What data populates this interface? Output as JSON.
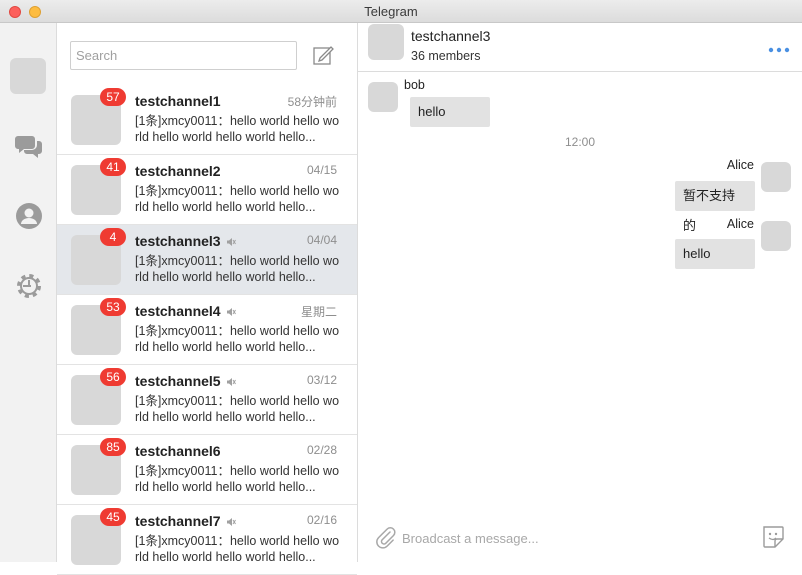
{
  "window": {
    "title": "Telegram"
  },
  "colors": {
    "badge": "#ef3b32",
    "active_row": "#e4e7eb",
    "bubble": "#e2e2e2",
    "accent": "#4a90e2"
  },
  "rail": {
    "icons": [
      "avatar",
      "chat-bubbles-icon",
      "contacts-icon",
      "settings-gear-icon"
    ]
  },
  "search": {
    "placeholder": "Search",
    "value": ""
  },
  "chats": [
    {
      "name": "testchannel1",
      "badge": "57",
      "time": "58分钟前",
      "muted": false,
      "active": false,
      "preview": "[1条]xmcy0011：hello world hello world hello world hello world hello..."
    },
    {
      "name": "testchannel2",
      "badge": "41",
      "time": "04/15",
      "muted": false,
      "active": false,
      "preview": "[1条]xmcy0011：hello world hello world hello world hello world hello..."
    },
    {
      "name": "testchannel3",
      "badge": "4",
      "time": "04/04",
      "muted": true,
      "active": true,
      "preview": "[1条]xmcy0011：hello world hello world hello world hello world hello..."
    },
    {
      "name": "testchannel4",
      "badge": "53",
      "time": "星期二",
      "muted": true,
      "active": false,
      "preview": "[1条]xmcy0011：hello world hello world hello world hello world hello..."
    },
    {
      "name": "testchannel5",
      "badge": "56",
      "time": "03/12",
      "muted": true,
      "active": false,
      "preview": "[1条]xmcy0011：hello world hello world hello world hello world hello..."
    },
    {
      "name": "testchannel6",
      "badge": "85",
      "time": "02/28",
      "muted": false,
      "active": false,
      "preview": "[1条]xmcy0011：hello world hello world hello world hello world hello..."
    },
    {
      "name": "testchannel7",
      "badge": "45",
      "time": "02/16",
      "muted": true,
      "active": false,
      "preview": "[1条]xmcy0011：hello world hello world hello world hello world hello..."
    }
  ],
  "conversation": {
    "name": "testchannel3",
    "members": "36 members",
    "messages": {
      "m1": {
        "author": "bob",
        "text": "hello"
      },
      "sep": "12:00",
      "m2": {
        "author": "Alice",
        "text": "暂不支持的"
      },
      "m3": {
        "author": "Alice",
        "text": "hello"
      }
    },
    "composer": {
      "placeholder": "Broadcast a message..."
    }
  }
}
